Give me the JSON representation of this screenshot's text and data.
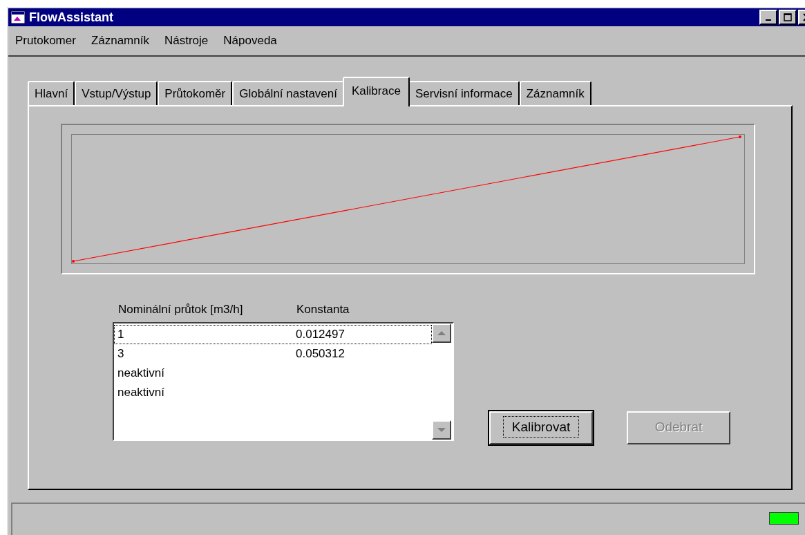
{
  "window": {
    "title": "FlowAssistant"
  },
  "menu": [
    {
      "label": "Prutokomer"
    },
    {
      "label": "Záznamník"
    },
    {
      "label": "Nástroje"
    },
    {
      "label": "Nápoveda"
    }
  ],
  "tabs": [
    {
      "label": "Hlavní",
      "selected": false
    },
    {
      "label": "Vstup/Výstup",
      "selected": false
    },
    {
      "label": "Průtokoměr",
      "selected": false
    },
    {
      "label": "Globální nastavení",
      "selected": false
    },
    {
      "label": "Kalibrace",
      "selected": true
    },
    {
      "label": "Servisní informace",
      "selected": false
    },
    {
      "label": "Záznamník",
      "selected": false
    }
  ],
  "calibration": {
    "columns": [
      "Nominální průtok [m3/h]",
      "Konstanta"
    ],
    "rows": [
      {
        "flow": "1",
        "constant": "0.012497",
        "selected": true
      },
      {
        "flow": "3",
        "constant": "0.050312",
        "selected": false
      },
      {
        "flow": "neaktivní",
        "selected": false
      },
      {
        "flow": "neaktivní",
        "selected": false
      }
    ],
    "buttons": [
      {
        "label": "Kalibrovat",
        "disabled": false,
        "default": true
      },
      {
        "label": "Odebrat",
        "disabled": true,
        "default": false
      }
    ]
  },
  "status_bar": {
    "indicator": {
      "color": "#00ff00"
    }
  }
}
